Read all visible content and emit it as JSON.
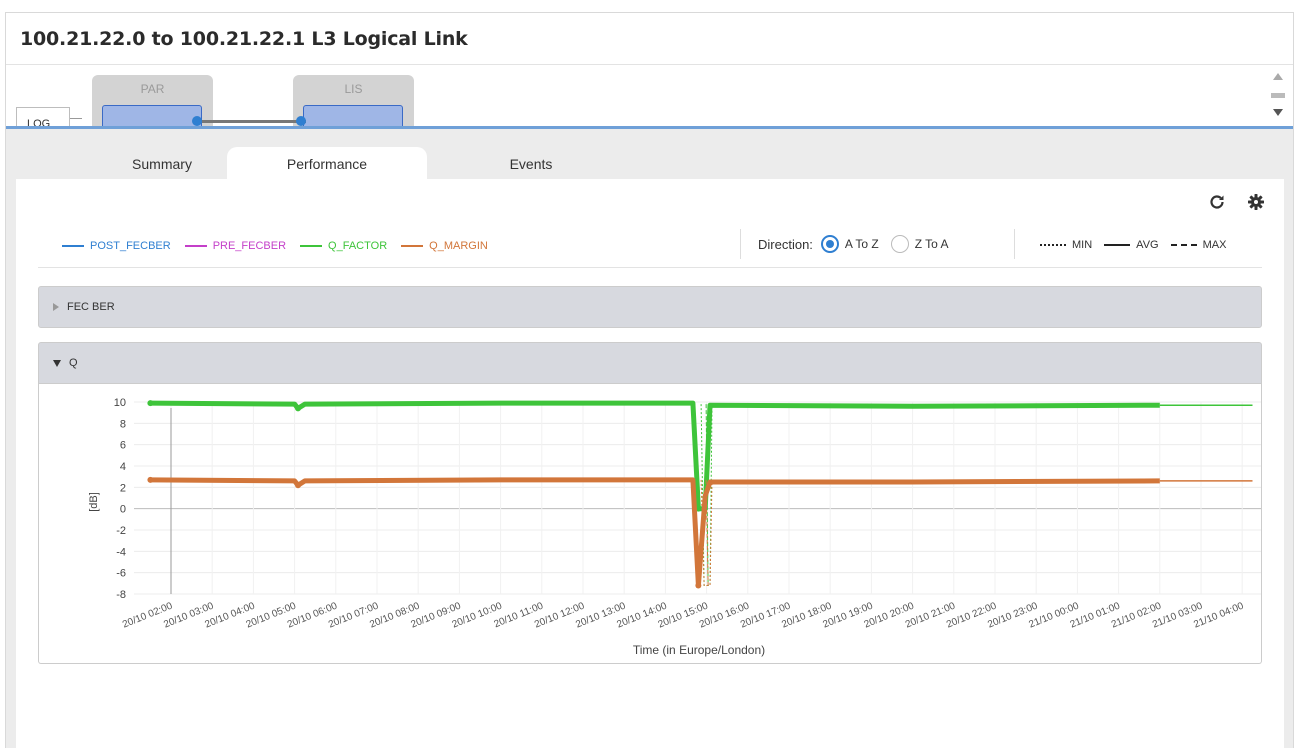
{
  "window": {
    "title": "100.21.22.0 to 100.21.22.1 L3 Logical Link"
  },
  "topology": {
    "log_tab_label": "LOG",
    "nodes": [
      {
        "label": "PAR"
      },
      {
        "label": "LIS"
      }
    ]
  },
  "tabs": [
    {
      "label": "Summary",
      "active": false
    },
    {
      "label": "Performance",
      "active": true
    },
    {
      "label": "Events",
      "active": false
    }
  ],
  "toolbar": {
    "refresh_icon": "refresh-icon",
    "settings_icon": "gear-icon"
  },
  "legend": [
    {
      "label": "POST_FECBER",
      "color": "#2f7fd1"
    },
    {
      "label": "PRE_FECBER",
      "color": "#c43fc9"
    },
    {
      "label": "Q_FACTOR",
      "color": "#3ec43a"
    },
    {
      "label": "Q_MARGIN",
      "color": "#d2763a"
    }
  ],
  "direction": {
    "label": "Direction:",
    "options": [
      "A To Z",
      "Z To A"
    ],
    "selected": "A To Z"
  },
  "stats_legend": [
    {
      "label": "MIN",
      "style": "dotted"
    },
    {
      "label": "AVG",
      "style": "solid"
    },
    {
      "label": "MAX",
      "style": "dashed"
    }
  ],
  "sections": [
    {
      "title": "FEC BER",
      "expanded": false
    },
    {
      "title": "Q",
      "expanded": true
    }
  ],
  "chart_data": {
    "type": "line",
    "title": "",
    "xlabel": "Time (in Europe/London)",
    "ylabel": "[dB]",
    "ylim": [
      -8,
      10
    ],
    "yticks": [
      10,
      8,
      6,
      4,
      2,
      0,
      -2,
      -4,
      -6,
      -8
    ],
    "x_categories": [
      "20/10 02:00",
      "20/10 03:00",
      "20/10 04:00",
      "20/10 05:00",
      "20/10 06:00",
      "20/10 07:00",
      "20/10 08:00",
      "20/10 09:00",
      "20/10 10:00",
      "20/10 11:00",
      "20/10 12:00",
      "20/10 13:00",
      "20/10 14:00",
      "20/10 15:00",
      "20/10 16:00",
      "20/10 17:00",
      "20/10 18:00",
      "20/10 19:00",
      "20/10 20:00",
      "20/10 21:00",
      "20/10 22:00",
      "20/10 23:00",
      "21/10 00:00",
      "21/10 01:00",
      "21/10 02:00",
      "21/10 03:00",
      "21/10 04:00"
    ],
    "grid": true,
    "series": [
      {
        "name": "Q_FACTOR",
        "color": "#3ec43a",
        "points": [
          [
            "20/10 01:30",
            9.9
          ],
          [
            "20/10 05:00",
            9.8
          ],
          [
            "20/10 05:05",
            9.4
          ],
          [
            "20/10 05:15",
            9.8
          ],
          [
            "20/10 10:00",
            9.9
          ],
          [
            "20/10 14:40",
            9.9
          ],
          [
            "20/10 14:48",
            0.0
          ],
          [
            "20/10 14:58",
            0.0
          ],
          [
            "20/10 15:05",
            9.7
          ],
          [
            "20/10 20:00",
            9.6
          ],
          [
            "21/10 02:00",
            9.7
          ],
          [
            "21/10 04:15",
            9.7
          ]
        ],
        "min_dip": -7.2,
        "max_dip": 9.8
      },
      {
        "name": "Q_MARGIN",
        "color": "#d2763a",
        "points": [
          [
            "20/10 01:30",
            2.7
          ],
          [
            "20/10 05:00",
            2.6
          ],
          [
            "20/10 05:05",
            2.2
          ],
          [
            "20/10 05:15",
            2.6
          ],
          [
            "20/10 10:00",
            2.7
          ],
          [
            "20/10 14:40",
            2.7
          ],
          [
            "20/10 14:48",
            -7.2
          ],
          [
            "20/10 14:58",
            1.2
          ],
          [
            "20/10 15:05",
            2.5
          ],
          [
            "20/10 20:00",
            2.5
          ],
          [
            "21/10 02:00",
            2.6
          ],
          [
            "21/10 04:15",
            2.6
          ]
        ],
        "min_dip": -7.2,
        "max_dip": 2.7
      }
    ]
  }
}
